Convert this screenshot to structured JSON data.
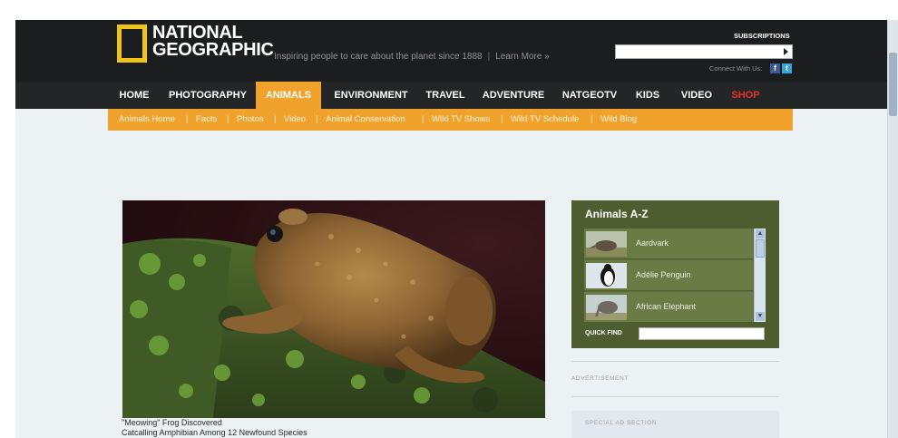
{
  "header": {
    "logo_line1": "NATIONAL",
    "logo_line2": "GEOGRAPHIC",
    "tagline": "Inspiring people to care about the planet since 1888",
    "learn_more": "Learn More »",
    "subscriptions": "SUBSCRIPTIONS",
    "search_value": "",
    "connect": "Connect With Us:",
    "brand_yellow": "#f0c419"
  },
  "nav": {
    "items": [
      {
        "label": "HOME"
      },
      {
        "label": "PHOTOGRAPHY"
      },
      {
        "label": "ANIMALS"
      },
      {
        "label": "ENVIRONMENT"
      },
      {
        "label": "TRAVEL"
      },
      {
        "label": "ADVENTURE"
      },
      {
        "label": "NATGEOTV"
      },
      {
        "label": "KIDS"
      },
      {
        "label": "VIDEO"
      },
      {
        "label": "SHOP"
      }
    ],
    "active": "ANIMALS",
    "accent": "#f0a22d",
    "shop_color": "#e8332a"
  },
  "subnav": {
    "items": [
      {
        "label": "Animals Home"
      },
      {
        "label": "Facts"
      },
      {
        "label": "Photos"
      },
      {
        "label": "Video"
      },
      {
        "label": "Animal Conservation"
      },
      {
        "label": "Wild TV Shows"
      },
      {
        "label": "Wild TV Schedule"
      },
      {
        "label": "Wild Blog"
      }
    ]
  },
  "feature": {
    "caption_title": "\"Meowing\" Frog Discovered",
    "caption_sub": "Catcalling Amphibian Among 12 Newfound Species"
  },
  "animals_az": {
    "title": "Animals A-Z",
    "items": [
      {
        "name": "Aardvark"
      },
      {
        "name": "Adélie Penguin"
      },
      {
        "name": "African Elephant"
      }
    ],
    "quick_find_label": "QUICK FIND",
    "quick_find_value": ""
  },
  "ads": {
    "advertisement_label": "ADVERTISEMENT",
    "special_label": "SPECIAL AD SECTION"
  }
}
